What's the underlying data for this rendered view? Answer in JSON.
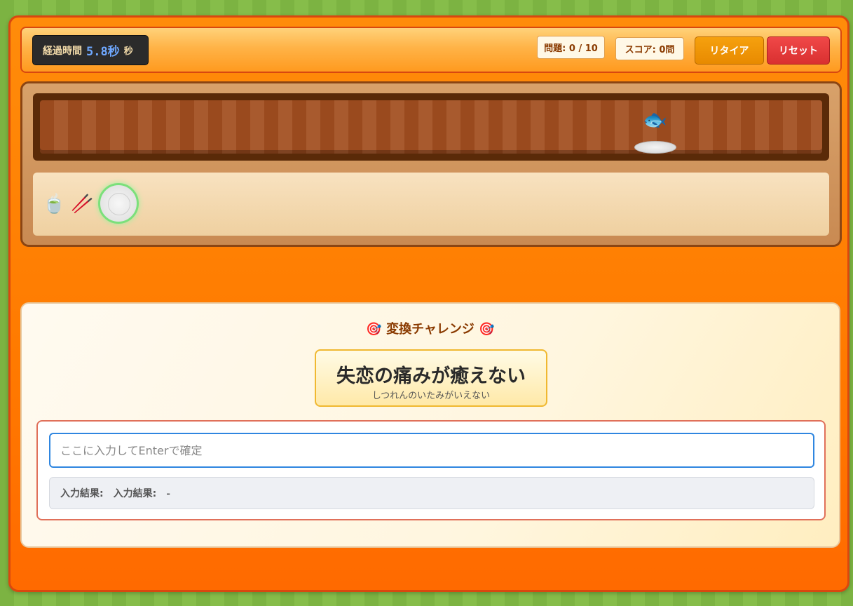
{
  "header": {
    "timer_label": "経過時間",
    "timer_value": "5.8秒",
    "timer_unit": "秒",
    "question_counter": "問題: 0 / 10",
    "score": "スコア: 0問",
    "retire_label": "リタイア",
    "reset_label": "リセット"
  },
  "belt": {
    "items": [
      {
        "icon": "fish",
        "glyph": "🐟"
      }
    ]
  },
  "seat": {
    "tea_glyph": "🍵",
    "chopsticks_glyph": "🥢"
  },
  "challenge": {
    "title_icon_left": "🎯",
    "title": "変換チャレンジ",
    "title_icon_right": "🎯",
    "target_text": "失恋の痛みが癒えない",
    "target_reading": "しつれんのいたみがいえない",
    "input_placeholder": "ここに入力してEnterで確定",
    "input_value": "",
    "result_label_1": "入力結果:",
    "result_label_2": "入力結果:",
    "result_value": "-"
  },
  "colors": {
    "frame": "#ff7a00",
    "accent_input": "#2f86e0",
    "reset_button": "#e03838",
    "retire_button": "#f09a08"
  }
}
